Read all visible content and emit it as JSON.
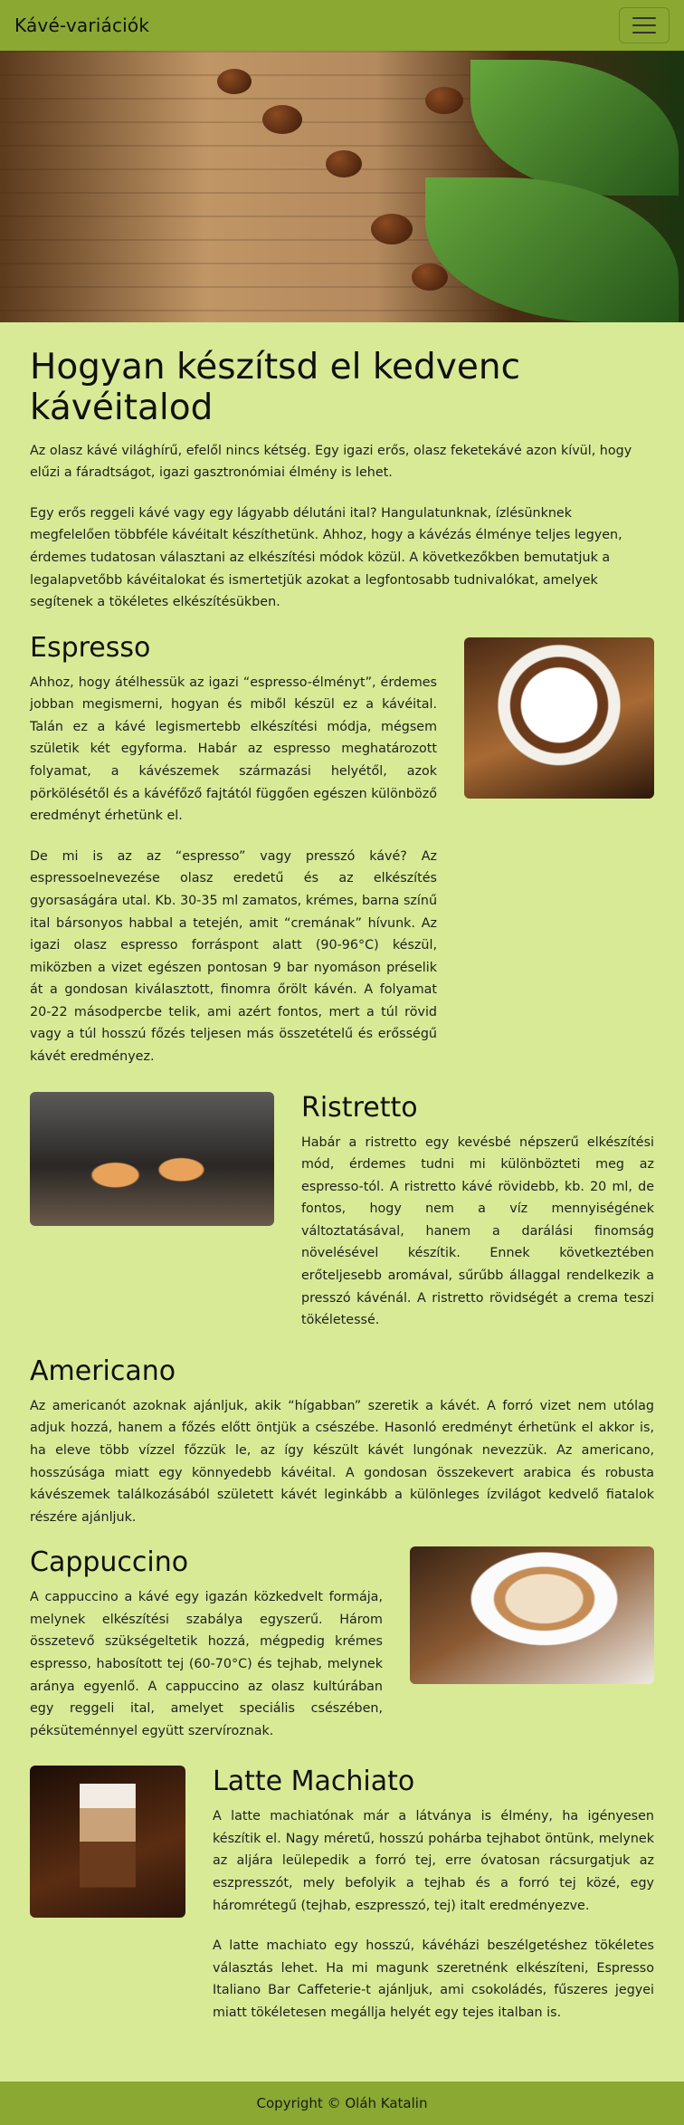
{
  "navbar": {
    "brand": "Kávé-variációk",
    "toggler_icon": "hamburger-menu-icon"
  },
  "hero": {
    "image": "coffee beans and green leaves on wooden table"
  },
  "intro": {
    "title": "Hogyan készítsd el kedvenc kávéitalod",
    "p1": "Az olasz kávé világhírű, efelől nincs kétség. Egy igazi erős, olasz feketekávé azon kívül, hogy elűzi a fáradtságot, igazi gasztronómiai élmény is lehet.",
    "p2": "Egy erős reggeli kávé vagy egy lágyabb délutáni ital? Hangulatunknak, ízlésünknek megfelelően többféle kávéitalt készíthetünk. Ahhoz, hogy a kávézás élménye teljes legyen, érdemes tudatosan választani az elkészítési módok közül. A következőkben bemutatjuk a legalapvetőbb kávéitalokat és ismertetjük azokat a legfontosabb tudnivalókat, amelyek segítenek a tökéletes elkészítésükben."
  },
  "espresso": {
    "title": "Espresso",
    "p1": "Ahhoz, hogy átélhessük az igazi “espresso-élményt”, érdemes jobban megismerni, hogyan és miből készül ez a kávéital. Talán ez a kávé legismertebb elkészítési módja, mégsem születik két egyforma. Habár az espresso meghatározott folyamat, a kávészemek származási helyétől, azok pörkölésétől és a kávéfőző fajtától függően egészen különböző eredményt érhetünk el.",
    "p2": "De mi is az az “espresso” vagy presszó kávé? Az espressoelnevezése olasz eredetű és az elkészítés gyorsaságára utal. Kb. 30-35 ml zamatos, krémes, barna színű ital bársonyos habbal a tetején, amit “cremának” hívunk. Az igazi olasz espresso forráspont alatt (90-96°C) készül, miközben a vizet egészen pontosan 9 bar nyomáson préselik át a gondosan kiválasztott, finomra őrölt kávén. A folyamat 20-22 másodpercbe telik, ami azért fontos, mert a túl rövid vagy a túl hosszú főzés teljesen más összetételű és erősségű kávét eredményez.",
    "image": "espresso cup with spoon"
  },
  "ristretto": {
    "title": "Ristretto",
    "p1": "Habár a ristretto egy kevésbé népszerű elkészítési mód, érdemes tudni mi különbözteti meg az espresso-tól. A ristretto kávé rövidebb, kb. 20 ml, de fontos, hogy nem a víz mennyiségének változtatásával, hanem a darálási finomság növelésével készítik. Ennek következtében erőteljesebb aromával, sűrűbb állaggal rendelkezik a presszó kávénál. A ristretto rövidségét a crema teszi tökéletessé.",
    "image": "two ristretto shot glasses"
  },
  "americano": {
    "title": "Americano",
    "p1": "Az americanót azoknak ajánljuk, akik “hígabban” szeretik a kávét. A forró vizet nem utólag adjuk hozzá, hanem a főzés előtt öntjük a csészébe. Hasonló eredményt érhetünk el akkor is, ha eleve több vízzel főzzük le, az így készült kávét lungónak nevezzük. Az americano, hosszúsága miatt egy könnyedebb kávéital. A gondosan összekevert arabica és robusta kávészemek találkozásából született kávét leginkább a különleges ízvilágot kedvelő fiatalok részére ajánljuk."
  },
  "cappuccino": {
    "title": "Cappuccino",
    "p1": "A cappuccino a kávé egy igazán közkedvelt formája, melynek elkészítési szabálya egyszerű. Három összetevő szükségeltetik hozzá, mégpedig krémes espresso, habosított tej (60-70°C) és tejhab, melynek aránya egyenlő. A cappuccino az olasz kultúrában egy reggeli ital, amelyet speciális csészében, péksüteménnyel együtt szervíroznak.",
    "image": "cappuccino with latte art"
  },
  "latte": {
    "title": "Latte Machiato",
    "p1": "A latte machiatónak már a látványa is élmény, ha igényesen készítik el. Nagy méretű, hosszú pohárba tejhabot öntünk, melynek az aljára leülepedik a forró tej, erre óvatosan rácsurgatjuk az eszpresszót, mely befolyik a tejhab és a forró tej közé, egy háromrétegű (tejhab, eszpresszó, tej) italt eredményezve.",
    "p2": "A latte machiato egy hosszú, kávéházi beszélgetéshez tökéletes választás lehet. Ha mi magunk szeretnénk elkészíteni, Espresso Italiano Bar Caffeterie-t ajánljuk, ami csokoládés, fűszeres jegyei miatt tökéletesen megállja helyét egy tejes italban is.",
    "image": "latte macchiato glass"
  },
  "footer": {
    "text": "Copyright © Oláh Katalin"
  },
  "colors": {
    "navbar": "#8aa832",
    "background": "#d8ea96",
    "footer": "#8aa832"
  }
}
